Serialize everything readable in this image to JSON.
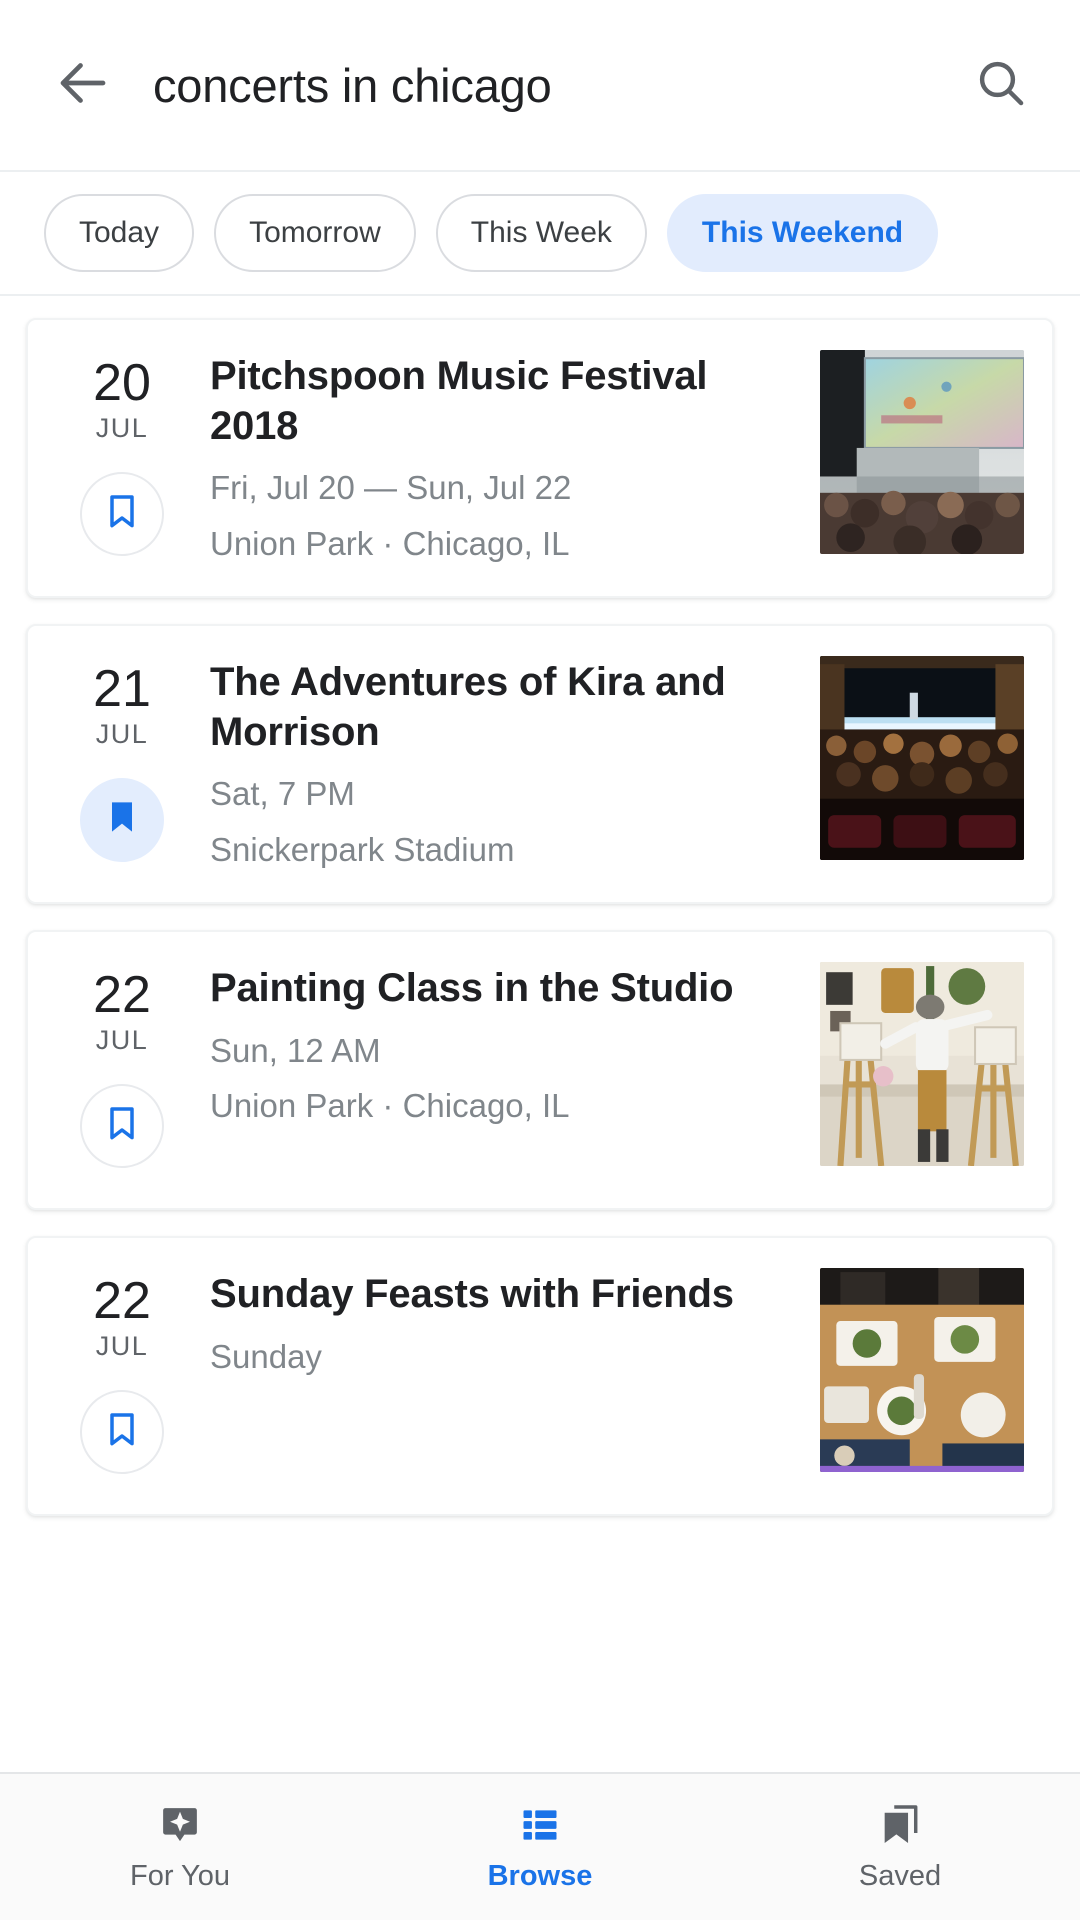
{
  "header": {
    "back_icon": "arrow-back-icon",
    "query": "concerts in chicago",
    "query_placeholder": "Search",
    "search_icon": "search-icon"
  },
  "filters": {
    "chips": [
      {
        "label": "Today",
        "active": false
      },
      {
        "label": "Tomorrow",
        "active": false
      },
      {
        "label": "This Week",
        "active": false
      },
      {
        "label": "This Weekend",
        "active": true
      }
    ]
  },
  "events": [
    {
      "day": "20",
      "month": "JUL",
      "title": "Pitchspoon Music Festival 2018",
      "when": "Fri, Jul 20 — Sun, Jul 22",
      "where": "Union Park · Chicago, IL",
      "saved": false,
      "bookmark_icon": "bookmark-outline-icon",
      "thumb_alt": "festival-crowd-stage-photo"
    },
    {
      "day": "21",
      "month": "JUL",
      "title": "The Adventures of Kira and Morrison",
      "when": "Sat, 7 PM",
      "where": "Snickerpark Stadium",
      "saved": true,
      "bookmark_icon": "bookmark-filled-icon",
      "thumb_alt": "theater-audience-stage-photo"
    },
    {
      "day": "22",
      "month": "JUL",
      "title": "Painting Class in the Studio",
      "when": "Sun, 12 AM",
      "where": "Union Park · Chicago, IL",
      "saved": false,
      "bookmark_icon": "bookmark-outline-icon",
      "thumb_alt": "painter-easel-studio-photo"
    },
    {
      "day": "22",
      "month": "JUL",
      "title": "Sunday Feasts with Friends",
      "when": "Sunday",
      "where": "",
      "saved": false,
      "bookmark_icon": "bookmark-outline-icon",
      "thumb_alt": "dinner-table-food-photo"
    }
  ],
  "bottom_nav": [
    {
      "label": "For You",
      "icon": "sparkle-badge-icon",
      "active": false
    },
    {
      "label": "Browse",
      "icon": "list-icon",
      "active": true
    },
    {
      "label": "Saved",
      "icon": "bookmarks-stack-icon",
      "active": false
    }
  ],
  "colors": {
    "accent": "#1a73e8",
    "chip_active_bg": "#e2ecfd",
    "saved_bg": "#e3edfd",
    "text_primary": "#202124",
    "text_secondary": "#80868b",
    "nav_inactive": "#5f6368"
  }
}
